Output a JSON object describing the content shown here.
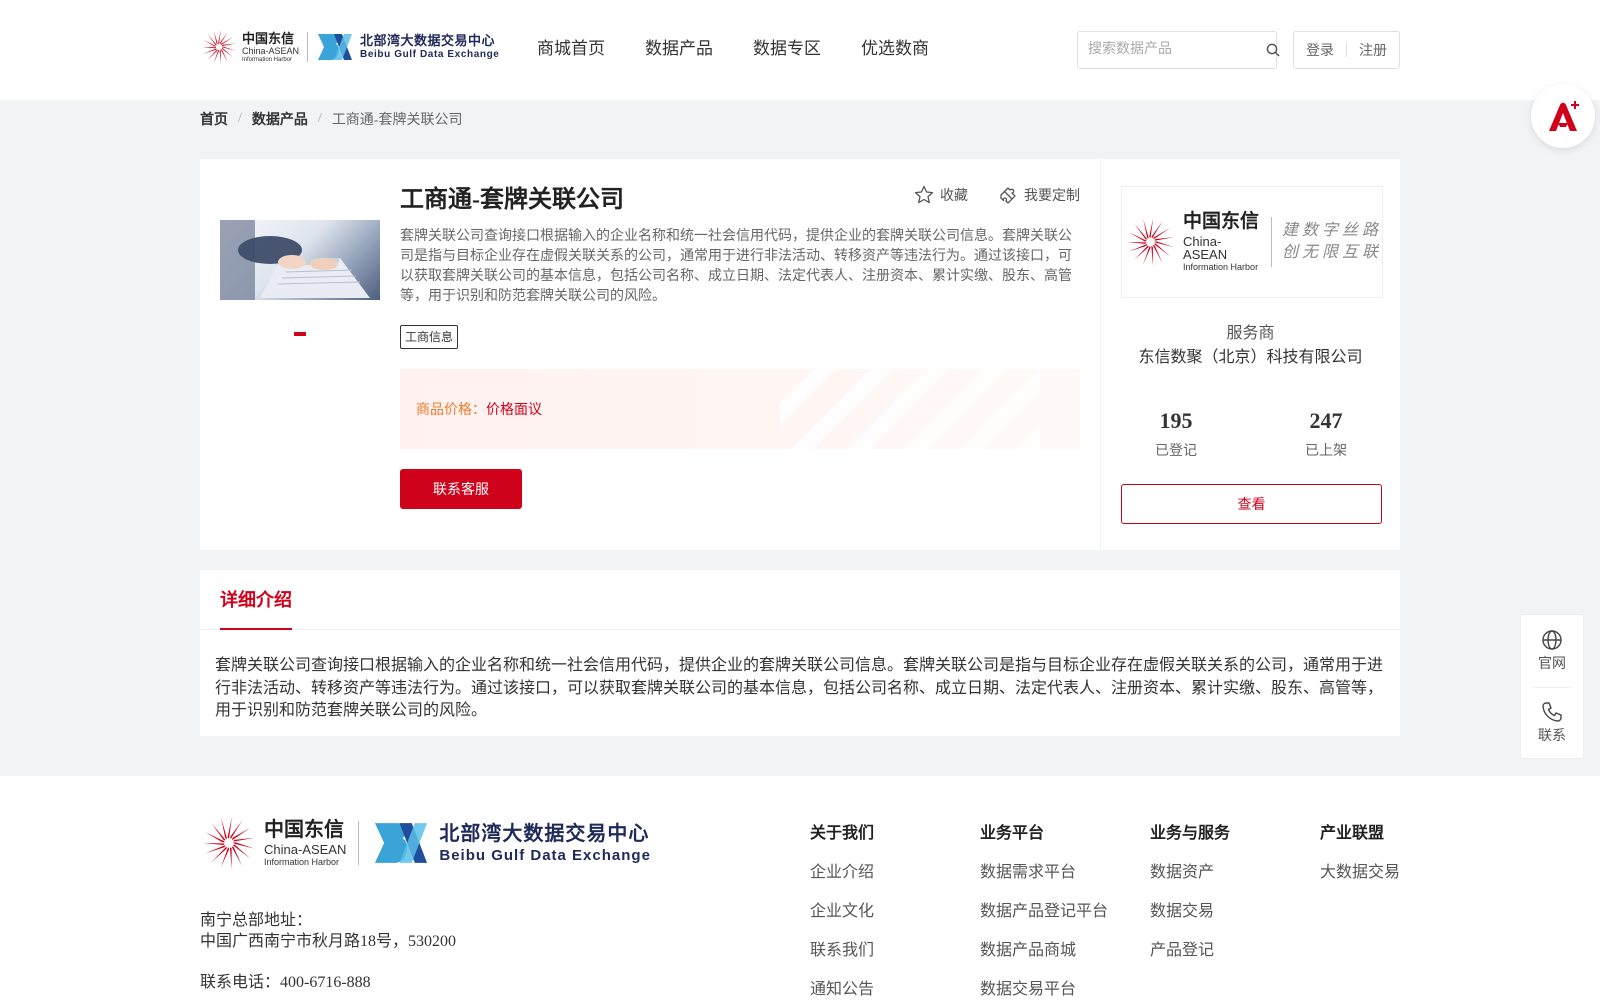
{
  "header": {
    "logo_ca_cn": "中国东信",
    "logo_ca_en1": "China-ASEAN",
    "logo_ca_en2": "Information Harbor",
    "logo_bb_cn": "北部湾大数据交易中心",
    "logo_bb_en": "Beibu Gulf Data Exchange",
    "nav": [
      "商城首页",
      "数据产品",
      "数据专区",
      "优选数商"
    ],
    "search_placeholder": "搜索数据产品",
    "login": "登录",
    "register": "注册"
  },
  "breadcrumb": {
    "home": "首页",
    "category": "数据产品",
    "current": "工商通-套牌关联公司"
  },
  "product": {
    "title": "工商通-套牌关联公司",
    "favorite": "收藏",
    "customize": "我要定制",
    "description": "套牌关联公司查询接口根据输入的企业名称和统一社会信用代码，提供企业的套牌关联公司信息。套牌关联公司是指与目标企业存在虚假关联关系的公司，通常用于进行非法活动、转移资产等违法行为。通过该接口，可以获取套牌关联公司的基本信息，包括公司名称、成立日期、法定代表人、注册资本、累计实缴、股东、高管等，用于识别和防范套牌关联公司的风险。",
    "tag": "工商信息",
    "price_label": "商品价格：",
    "price_value": "价格面议",
    "contact_button": "联系客服"
  },
  "vendor": {
    "logo_cn": "中国东信",
    "logo_en1": "China-ASEAN",
    "logo_en2": "Information Harbor",
    "slogan_line1": "建数字丝路",
    "slogan_line2": "创无限互联",
    "label": "服务商",
    "name": "东信数聚（北京）科技有限公司",
    "registered_count": "195",
    "registered_label": "已登记",
    "listed_count": "247",
    "listed_label": "已上架",
    "view_button": "查看"
  },
  "detail": {
    "tab": "详细介绍",
    "body": "套牌关联公司查询接口根据输入的企业名称和统一社会信用代码，提供企业的套牌关联公司信息。套牌关联公司是指与目标企业存在虚假关联关系的公司，通常用于进行非法活动、转移资产等违法行为。通过该接口，可以获取套牌关联公司的基本信息，包括公司名称、成立日期、法定代表人、注册资本、累计实缴、股东、高管等，用于识别和防范套牌关联公司的风险。"
  },
  "side_float": {
    "website": "官网",
    "contact": "联系"
  },
  "footer": {
    "address_label": "南宁总部地址：",
    "address": "中国广西南宁市秋月路18号，530200",
    "phone": "联系电话：400-6716-888",
    "columns": [
      {
        "title": "关于我们",
        "links": [
          "企业介绍",
          "企业文化",
          "联系我们",
          "通知公告"
        ]
      },
      {
        "title": "业务平台",
        "links": [
          "数据需求平台",
          "数据产品登记平台",
          "数据产品商城",
          "数据交易平台"
        ]
      },
      {
        "title": "业务与服务",
        "links": [
          "数据资产",
          "数据交易",
          "产品登记"
        ]
      },
      {
        "title": "产业联盟",
        "links": [
          "大数据交易"
        ]
      }
    ]
  },
  "colors": {
    "brand_red": "#d0021b",
    "price_orange": "#f07c2a",
    "navy": "#1e2a5a"
  },
  "icons": [
    "sunburst-logo-icon",
    "bx-logo-icon",
    "search-icon",
    "star-icon",
    "puzzle-icon",
    "ai-assistant-icon",
    "globe-icon",
    "phone-icon"
  ]
}
